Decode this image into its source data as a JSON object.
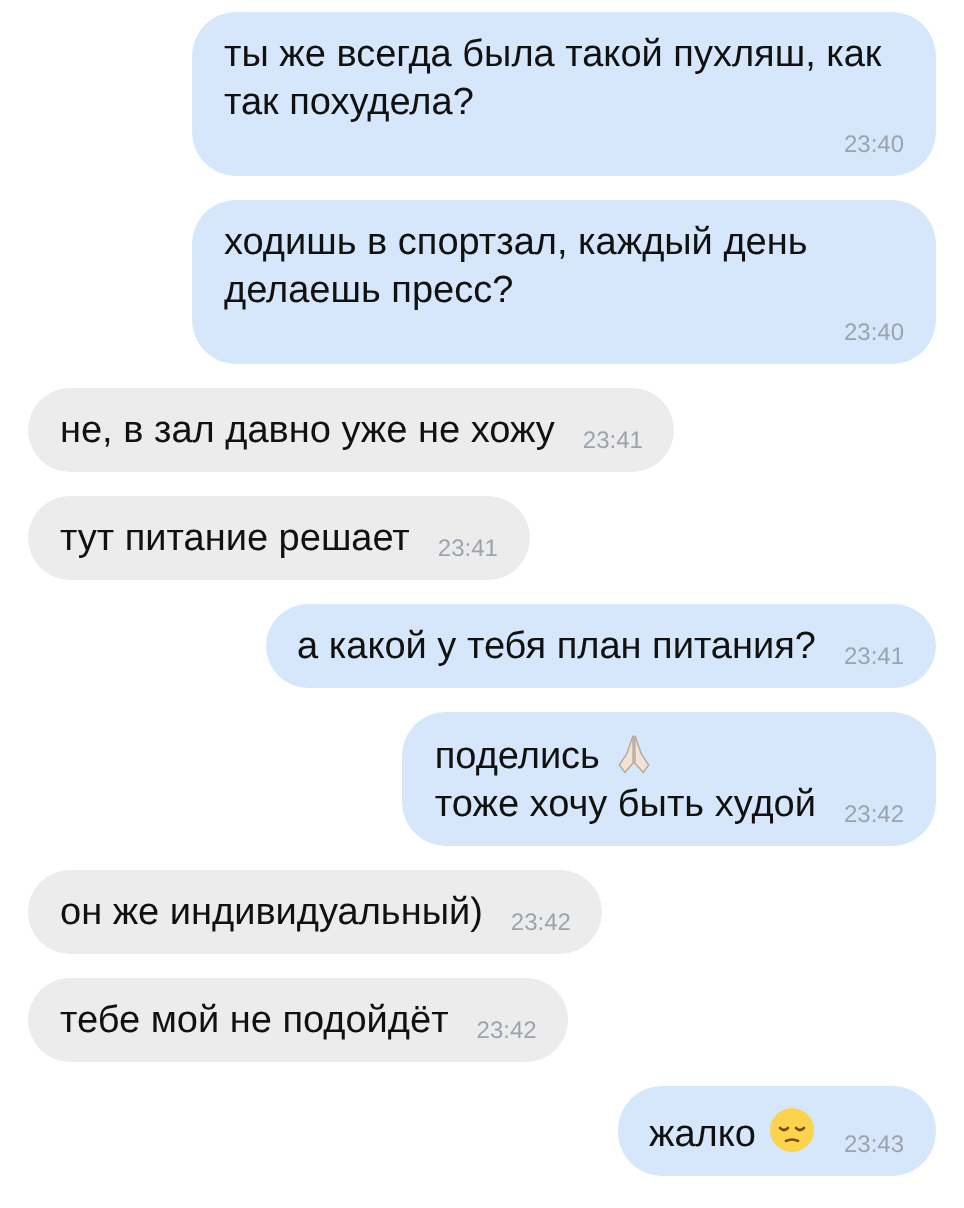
{
  "messages": [
    {
      "outgoing": true,
      "parts": [
        {
          "kind": "text",
          "text": "ты же всегда была такой пухляш, как так похудела?"
        }
      ],
      "time": "23:40"
    },
    {
      "outgoing": true,
      "parts": [
        {
          "kind": "text",
          "text": "ходишь в спортзал, каждый день делаешь пресс?"
        }
      ],
      "time": "23:40"
    },
    {
      "outgoing": false,
      "parts": [
        {
          "kind": "text",
          "text": "не, в зал давно уже не хожу"
        }
      ],
      "time": "23:41"
    },
    {
      "outgoing": false,
      "parts": [
        {
          "kind": "text",
          "text": "тут питание решает"
        }
      ],
      "time": "23:41"
    },
    {
      "outgoing": true,
      "parts": [
        {
          "kind": "text",
          "text": "а какой у тебя план питания?"
        }
      ],
      "time": "23:41"
    },
    {
      "outgoing": true,
      "parts": [
        {
          "kind": "text",
          "text": "поделись"
        },
        {
          "kind": "pray"
        },
        {
          "kind": "break"
        },
        {
          "kind": "text",
          "text": "тоже хочу быть худой"
        }
      ],
      "time": "23:42"
    },
    {
      "outgoing": false,
      "parts": [
        {
          "kind": "text",
          "text": "он же индивидуальный)"
        }
      ],
      "time": "23:42"
    },
    {
      "outgoing": false,
      "parts": [
        {
          "kind": "text",
          "text": "тебе мой не подойдёт"
        }
      ],
      "time": "23:42"
    },
    {
      "outgoing": true,
      "parts": [
        {
          "kind": "text",
          "text": "жалко"
        },
        {
          "kind": "pensive"
        }
      ],
      "time": "23:43"
    }
  ]
}
